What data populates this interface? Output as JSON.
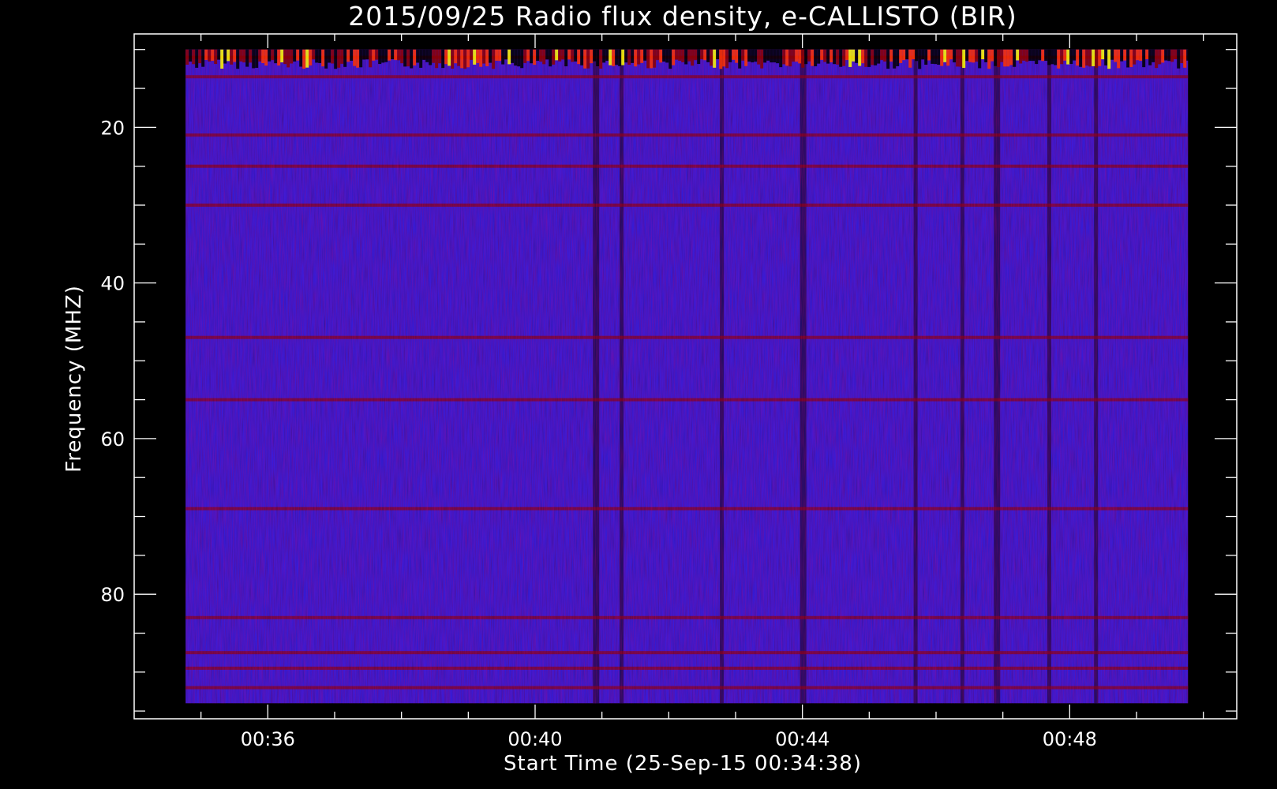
{
  "chart_data": {
    "type": "heatmap",
    "title": "2015/09/25  Radio flux density, e-CALLISTO (BIR)",
    "xlabel": "Start Time (25-Sep-15 00:34:38)",
    "ylabel": "Frequency (MHZ)",
    "x_ticks": [
      "00:36",
      "00:40",
      "00:44",
      "00:48"
    ],
    "x_tick_minutes": [
      36,
      40,
      44,
      48
    ],
    "xlim_minutes": [
      34.0,
      50.5
    ],
    "data_extent_minutes": [
      34.77,
      49.77
    ],
    "y_ticks": [
      20,
      40,
      60,
      80
    ],
    "ylim": [
      8,
      96
    ],
    "data_extent_frequency": [
      10,
      94
    ],
    "y_axis_inverted": true,
    "colormap": [
      "#000000",
      "#0000ff",
      "#8b0000",
      "#ff3300",
      "#ffff00"
    ],
    "background_level_color": "#2a1fe8",
    "bright_rows_mhz": [
      11,
      13.5,
      21,
      25,
      30,
      47,
      55,
      69,
      83,
      87.5,
      89.5,
      92
    ],
    "dark_columns_minutes": [
      40.9,
      41.3,
      42.8,
      44.0,
      45.7,
      46.4,
      46.9,
      47.7,
      48.4
    ]
  }
}
